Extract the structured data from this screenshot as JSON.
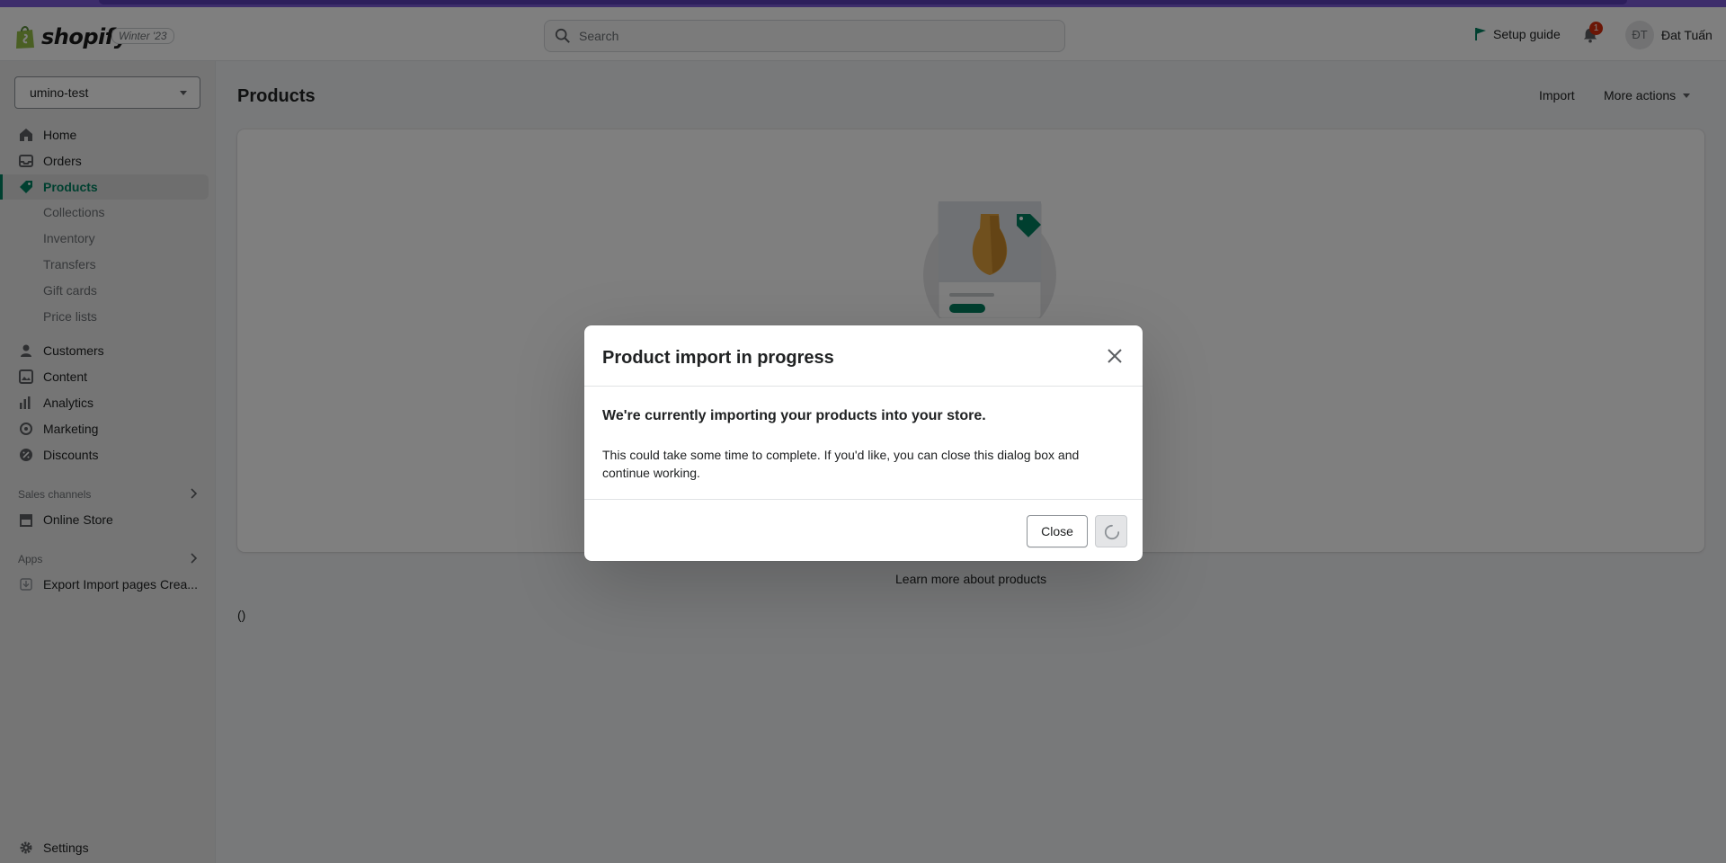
{
  "topbar": {
    "logo_text": "shopify",
    "edition": "Winter '23",
    "search_placeholder": "Search",
    "setup_guide": "Setup guide",
    "notification_count": "1",
    "avatar_initials": "ĐT",
    "user_name": "Đat Tuấn"
  },
  "sidebar": {
    "store_name": "umino-test",
    "nav": [
      {
        "label": "Home",
        "icon": "home-icon"
      },
      {
        "label": "Orders",
        "icon": "orders-icon"
      },
      {
        "label": "Products",
        "icon": "tag-icon"
      },
      {
        "label": "Customers",
        "icon": "person-icon"
      },
      {
        "label": "Content",
        "icon": "image-icon"
      },
      {
        "label": "Analytics",
        "icon": "bar-chart-icon"
      },
      {
        "label": "Marketing",
        "icon": "target-icon"
      },
      {
        "label": "Discounts",
        "icon": "discount-icon"
      }
    ],
    "product_sub": [
      "Collections",
      "Inventory",
      "Transfers",
      "Gift cards",
      "Price lists"
    ],
    "sales_channels_heading": "Sales channels",
    "online_store": "Online Store",
    "apps_heading": "Apps",
    "app_item": "Export Import pages Crea...",
    "settings": "Settings"
  },
  "main": {
    "title": "Products",
    "import_label": "Import",
    "more_actions_label": "More actions",
    "learn_more_prefix": "Learn more about ",
    "learn_more_link": "products",
    "paren_text": "()"
  },
  "modal": {
    "title": "Product import in progress",
    "lead": "We're currently importing your products into your store.",
    "text": "This could take some time to complete. If you'd like, you can close this dialog box and continue working.",
    "close_label": "Close"
  },
  "colors": {
    "accent": "#008060",
    "brand_strip": "#7b5bd6",
    "link": "#2c6ecb",
    "badge": "#d72c0d"
  }
}
